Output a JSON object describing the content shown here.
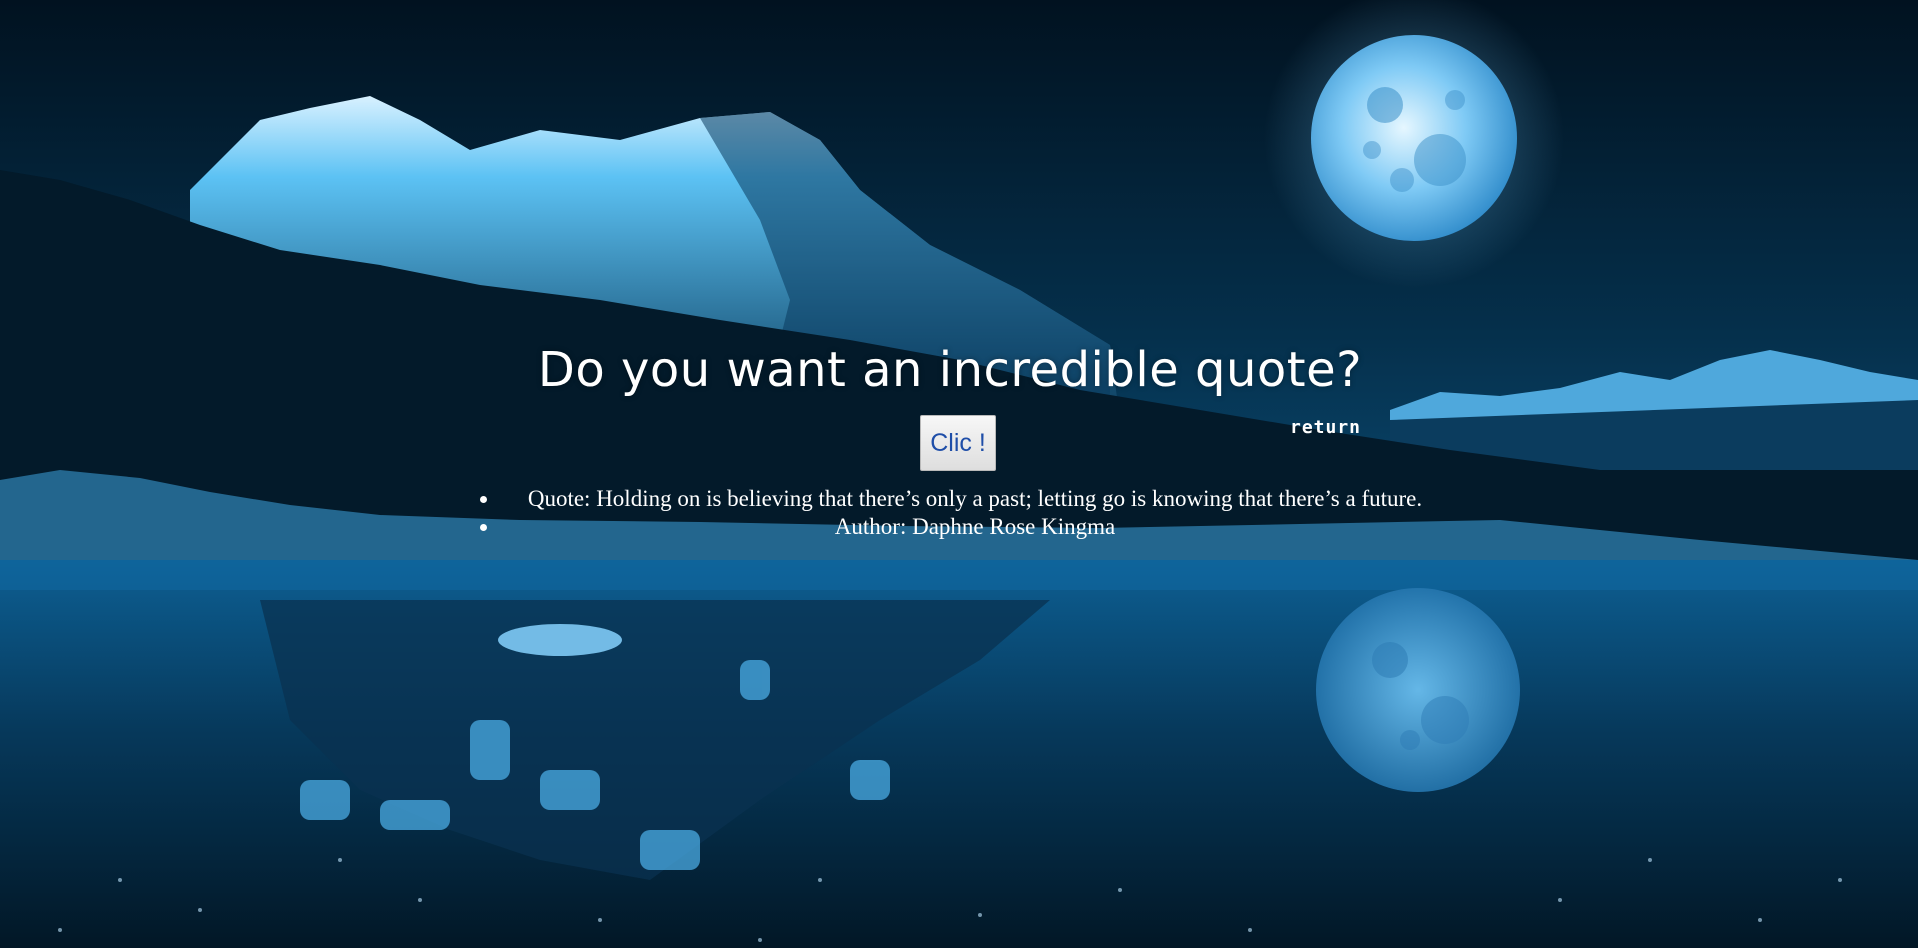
{
  "page": {
    "headline": "Do you want an incredible quote?",
    "return_label": "return",
    "button_label": "Clic !"
  },
  "quote": {
    "quote_line": "Quote: Holding on is believing that there’s only a past; letting go is knowing that there’s a future.",
    "author_line": "Author: Daphne Rose Kingma"
  },
  "colors": {
    "sky_top": "#021523",
    "sky_mid": "#063553",
    "mountain_ice": "#5ec4f6",
    "forest_dark": "#031624",
    "water": "#0a4f7f",
    "moon": "#9ed9ff",
    "text": "#ffffff",
    "button_text": "#1f4ea8"
  },
  "background": {
    "description_icon": "night-mountain-lake-icon"
  }
}
